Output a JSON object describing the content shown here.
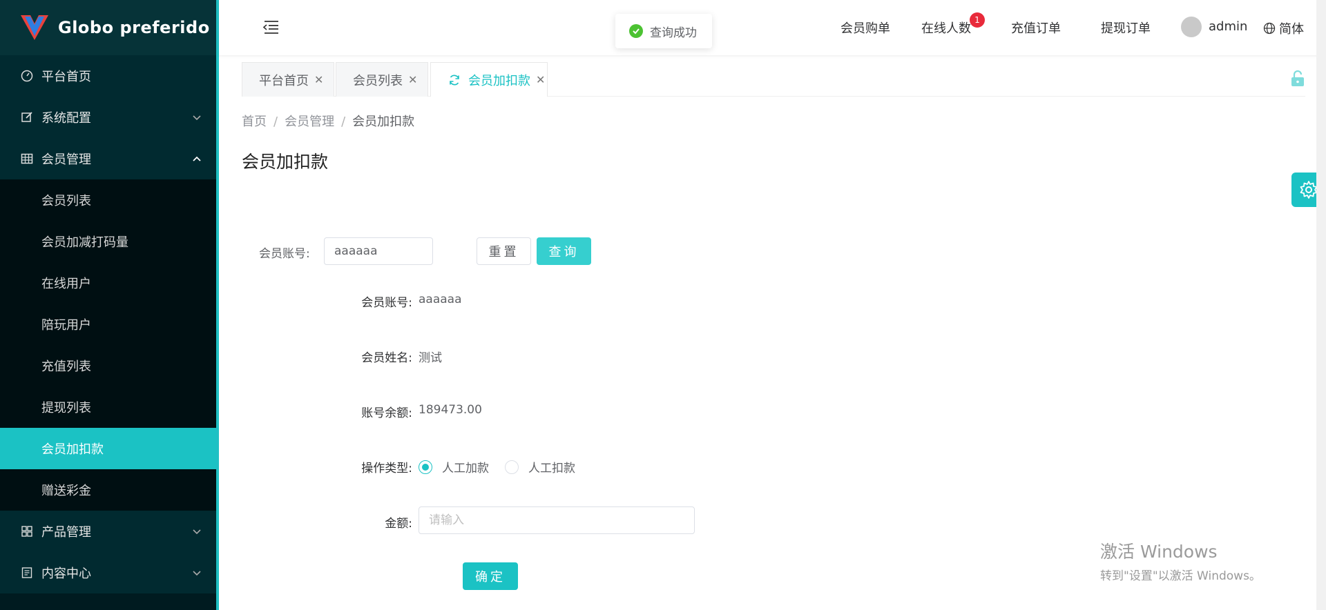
{
  "app": {
    "logo_text": "Globo preferido",
    "accent": "#1bc2c4"
  },
  "sidebar": {
    "items": [
      {
        "label": "平台首页",
        "icon": "dashboard-icon"
      },
      {
        "label": "系统配置",
        "icon": "edit-icon"
      },
      {
        "label": "会员管理",
        "icon": "grid-icon"
      }
    ],
    "subitems": [
      {
        "label": "会员列表"
      },
      {
        "label": "会员加减打码量"
      },
      {
        "label": "在线用户"
      },
      {
        "label": "陪玩用户"
      },
      {
        "label": "充值列表"
      },
      {
        "label": "提现列表"
      },
      {
        "label": "会员加扣款"
      },
      {
        "label": "赠送彩金"
      }
    ],
    "bottom_items": [
      {
        "label": "产品管理",
        "icon": "apps-icon"
      },
      {
        "label": "内容中心",
        "icon": "document-icon"
      }
    ]
  },
  "header": {
    "toast": "查询成功",
    "links": [
      "会员购单",
      "在线人数",
      "充值订单",
      "提现订单"
    ],
    "online_badge": "1",
    "user": "admin",
    "language": "简体"
  },
  "tabs": [
    {
      "label": "平台首页"
    },
    {
      "label": "会员列表"
    },
    {
      "label": "会员加扣款"
    }
  ],
  "breadcrumb": {
    "home": "首页",
    "section": "会员管理",
    "current": "会员加扣款",
    "sep": "/"
  },
  "page_title": "会员加扣款",
  "search": {
    "label": "会员账号:",
    "value": "aaaaaa",
    "reset_label": "重置",
    "query_label": "查询"
  },
  "form": {
    "account_label": "会员账号:",
    "account_value": "aaaaaa",
    "name_label": "会员姓名:",
    "name_value": "测试",
    "balance_label": "账号余额:",
    "balance_value": "189473.00",
    "type_label": "操作类型:",
    "type_options": [
      "人工加款",
      "人工扣款"
    ],
    "type_selected": "人工加款",
    "amount_label": "金额:",
    "amount_placeholder": "请输入",
    "confirm_label": "确定"
  },
  "watermark": {
    "line1": "激活 Windows",
    "line2": "转到\"设置\"以激活 Windows。"
  }
}
